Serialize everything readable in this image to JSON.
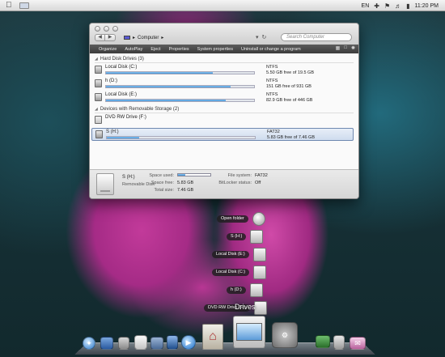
{
  "menubar": {
    "apple": "",
    "lang": "EN",
    "clock": "11:20 PM"
  },
  "window": {
    "breadcrumb_root": "Computer",
    "search_placeholder": "Search Computer",
    "toolbar": [
      "Organize",
      "AutoPlay",
      "Eject",
      "Properties",
      "System properties",
      "Uninstall or change a program"
    ],
    "groups": {
      "hard_disks": "Hard Disk Drives (3)",
      "removable": "Devices with Removable Storage (2)"
    },
    "drives": [
      {
        "name": "Local Disk (C:)",
        "fs": "NTFS",
        "free": "5.50 GB free of 19.5 GB",
        "used_fraction": 0.72
      },
      {
        "name": "h (D:)",
        "fs": "NTFS",
        "free": "151 GB free of 931 GB",
        "used_fraction": 0.84
      },
      {
        "name": "Local Disk (E:)",
        "fs": "NTFS",
        "free": "82.9 GB free of 446 GB",
        "used_fraction": 0.81
      }
    ],
    "removable": [
      {
        "name": "DVD RW Drive (F:)"
      },
      {
        "name": "S (H:)",
        "fs": "FAT32",
        "free": "5.83 GB free of 7.46 GB",
        "used_fraction": 0.22
      }
    ],
    "details": {
      "name": "S (H:)",
      "type": "Removable Disk",
      "space_used_label": "Space used:",
      "space_free_label": "Space free:",
      "space_free": "5.83 GB",
      "total_size_label": "Total size:",
      "total_size": "7.46 GB",
      "file_system_label": "File system:",
      "file_system": "FAT32",
      "bitlocker_label": "BitLocker status:",
      "bitlocker": "Off",
      "used_fraction": 0.22
    }
  },
  "stack": {
    "items": [
      "Open folder",
      "S (H:)",
      "Local Disk (E:)",
      "Local Disk (C:)",
      "h (D:)",
      "DVD RW Drive (F:)"
    ],
    "title": "Drives"
  },
  "dock": {
    "icons": [
      "safari-icon",
      "system-icon",
      "calculator-icon",
      "textedit-icon",
      "tools-icon",
      "itunes-icon",
      "media-icon",
      "home-icon",
      "imac-icon",
      "system-preferences-icon",
      "monitor-icon",
      "trash-icon",
      "mail-icon"
    ]
  }
}
